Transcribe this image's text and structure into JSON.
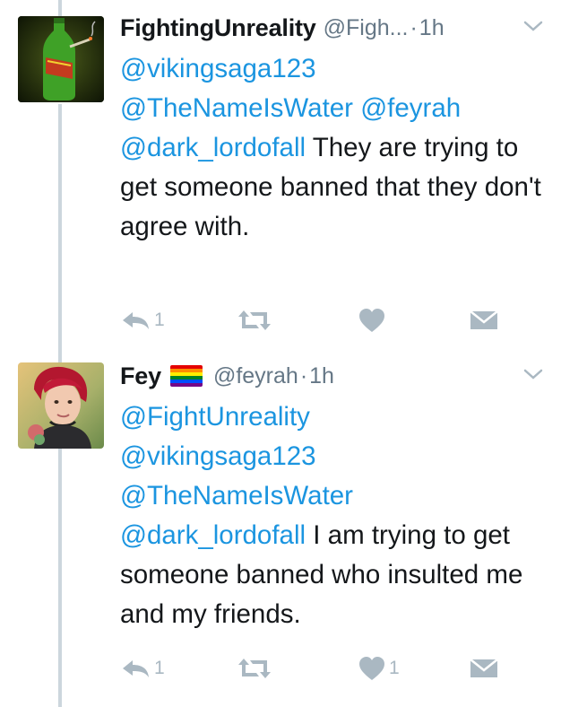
{
  "tweets": [
    {
      "display_name": "FightingUnreality",
      "handle": "@Figh...",
      "separator": "·",
      "time": "1h",
      "mentions": [
        "@vikingsaga123",
        "@TheNameIsWater",
        "@feyrah",
        "@dark_lordofall"
      ],
      "text": "They are trying to get someone banned that they don't agree with.",
      "reply_count": "1",
      "retweet_count": "",
      "like_count": "",
      "liked": false
    },
    {
      "display_name": "Fey",
      "name_badge": "rainbow-flag-emoji",
      "handle": "@feyrah",
      "separator": "·",
      "time": "1h",
      "mentions": [
        "@FightUnreality",
        "@vikingsaga123",
        "@TheNameIsWater",
        "@dark_lordofall"
      ],
      "text": "I am trying to get someone banned who insulted me and my friends.",
      "reply_count": "1",
      "retweet_count": "",
      "like_count": "1",
      "liked": false
    }
  ],
  "icons": {
    "reply": "reply-icon",
    "retweet": "retweet-icon",
    "like": "heart-icon",
    "message": "direct-message-icon",
    "more": "chevron-down-icon"
  },
  "colors": {
    "link": "#1b95e0",
    "text": "#14171a",
    "secondary": "#657786",
    "action_icon": "#aab8c2",
    "thread_line": "#ccd6dd"
  }
}
